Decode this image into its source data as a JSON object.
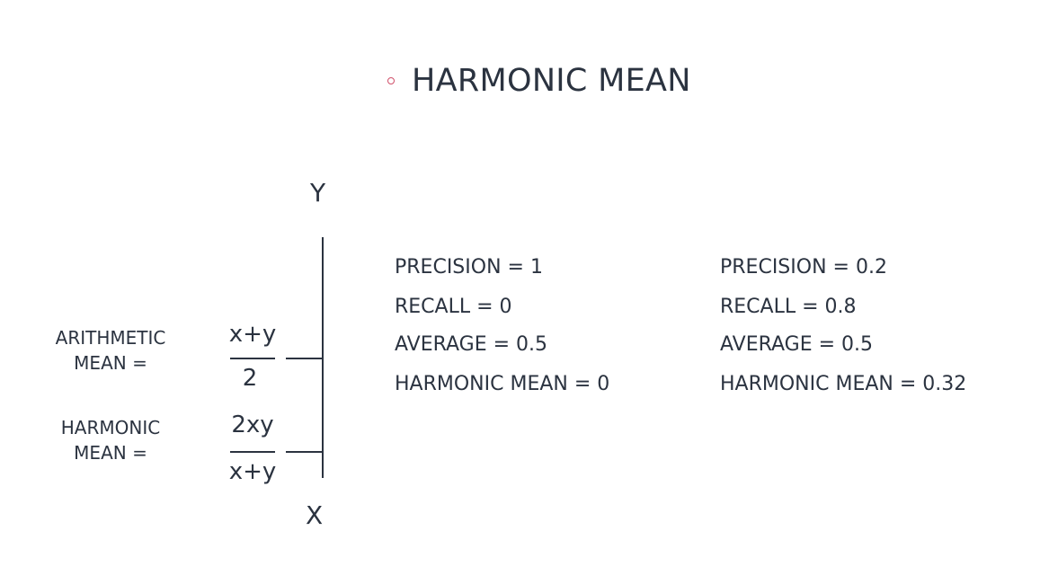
{
  "title": "HARMONIC MEAN",
  "axis": {
    "y_label": "Y",
    "x_label": "X"
  },
  "formulas": {
    "arithmetic": {
      "label_line1": "ARITHMETIC",
      "label_line2": "MEAN =",
      "numerator": "x+y",
      "denominator": "2"
    },
    "harmonic": {
      "label_line1": "HARMONIC",
      "label_line2": "MEAN  =",
      "numerator": "2xy",
      "denominator": "x+y"
    }
  },
  "examples": [
    {
      "precision": "PRECISION = 1",
      "recall": "RECALL = 0",
      "average": "AVERAGE = 0.5",
      "harmonic_mean": "HARMONIC MEAN = 0"
    },
    {
      "precision": "PRECISION = 0.2",
      "recall": "RECALL = 0.8",
      "average": "AVERAGE = 0.5",
      "harmonic_mean": "HARMONIC MEAN = 0.32"
    }
  ],
  "colors": {
    "bullet": "#d0506a",
    "text": "#2b3340"
  }
}
